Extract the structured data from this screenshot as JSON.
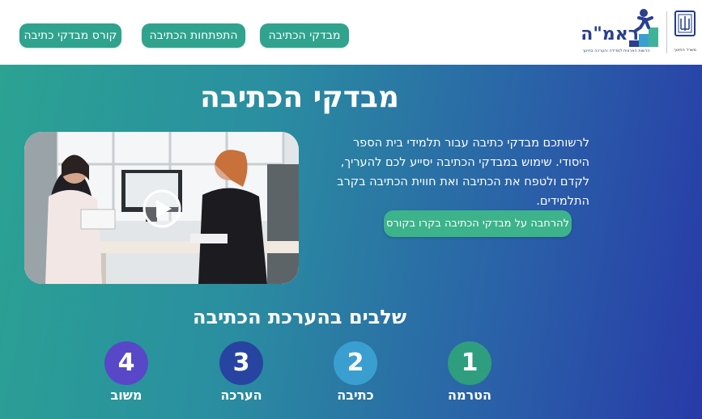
{
  "header": {
    "nav": [
      {
        "label": "קורס מבדקי כתיבה"
      },
      {
        "label": "התפתחות הכתיבה"
      },
      {
        "label": "מבדקי הכתיבה"
      }
    ],
    "logo": {
      "name": "ראמ\"ה",
      "subtitle": "הרשות הארצית למדידה והערכה בחינוך"
    },
    "ministry": {
      "label": "משרד החינוך"
    }
  },
  "hero": {
    "title": "מבדקי הכתיבה",
    "paragraph": "לרשותכם מבדקי כתיבה עבור תלמידי בית הספר היסודי. שימוש במבדקי הכתיבה יסייע לכם להעריך, לקדם ולטפח את הכתיבה ואת חווית הכתיבה בקרב התלמידים.",
    "more_button": "להרחבה על מבדקי הכתיבה בקרו בקורס"
  },
  "steps": {
    "title": "שלבים בהערכת הכתיבה",
    "items": [
      {
        "number": "1",
        "label": "הטרמה"
      },
      {
        "number": "2",
        "label": "כתיבה"
      },
      {
        "number": "3",
        "label": "הערכה"
      },
      {
        "number": "4",
        "label": "משוב"
      }
    ]
  },
  "colors": {
    "nav_button": "#2fa38d",
    "gradient_start": "#2ba292",
    "gradient_end": "#283aa8",
    "step1": "#2e9e7e",
    "step2": "#3a9fd0",
    "step3": "#2744a0",
    "step4": "#5848c8"
  }
}
